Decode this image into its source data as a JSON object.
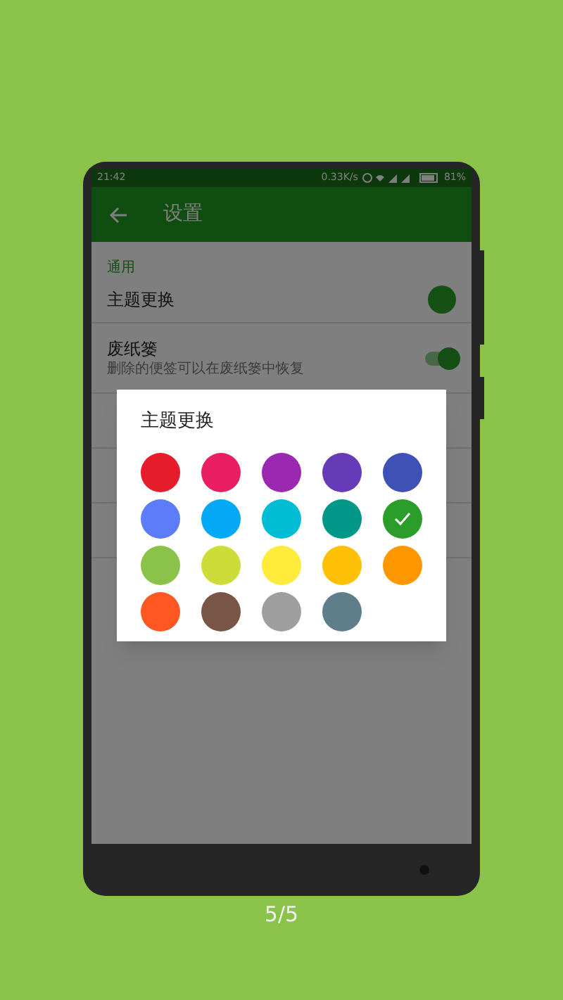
{
  "status_bar": {
    "time": "21:42",
    "speed": "0.33K/s",
    "battery": "81%"
  },
  "app_bar": {
    "title": "设置"
  },
  "settings": {
    "section": "通用",
    "rows": [
      {
        "kind": "color",
        "title": "主题更换",
        "color": "#155015"
      },
      {
        "kind": "switch",
        "title": "废纸篓",
        "subtitle": "删除的便签可以在废纸篓中恢复",
        "on": true
      }
    ]
  },
  "dialog": {
    "title": "主题更换",
    "colors": [
      {
        "color": "#e61c2b",
        "selected": false
      },
      {
        "color": "#e91e63",
        "selected": false
      },
      {
        "color": "#9c27b0",
        "selected": false
      },
      {
        "color": "#673ab7",
        "selected": false
      },
      {
        "color": "#3f51b5",
        "selected": false
      },
      {
        "color": "#5c7cfa",
        "selected": false
      },
      {
        "color": "#03a9f4",
        "selected": false
      },
      {
        "color": "#00bcd4",
        "selected": false
      },
      {
        "color": "#009688",
        "selected": false
      },
      {
        "color": "#2a9d2a",
        "selected": true
      },
      {
        "color": "#8bc34a",
        "selected": false
      },
      {
        "color": "#cddc39",
        "selected": false
      },
      {
        "color": "#ffeb3b",
        "selected": false
      },
      {
        "color": "#ffc107",
        "selected": false
      },
      {
        "color": "#ff9800",
        "selected": false
      },
      {
        "color": "#ff5722",
        "selected": false
      },
      {
        "color": "#795548",
        "selected": false
      },
      {
        "color": "#9e9e9e",
        "selected": false
      },
      {
        "color": "#607d8b",
        "selected": false
      }
    ]
  },
  "page_indicator": "5/5"
}
